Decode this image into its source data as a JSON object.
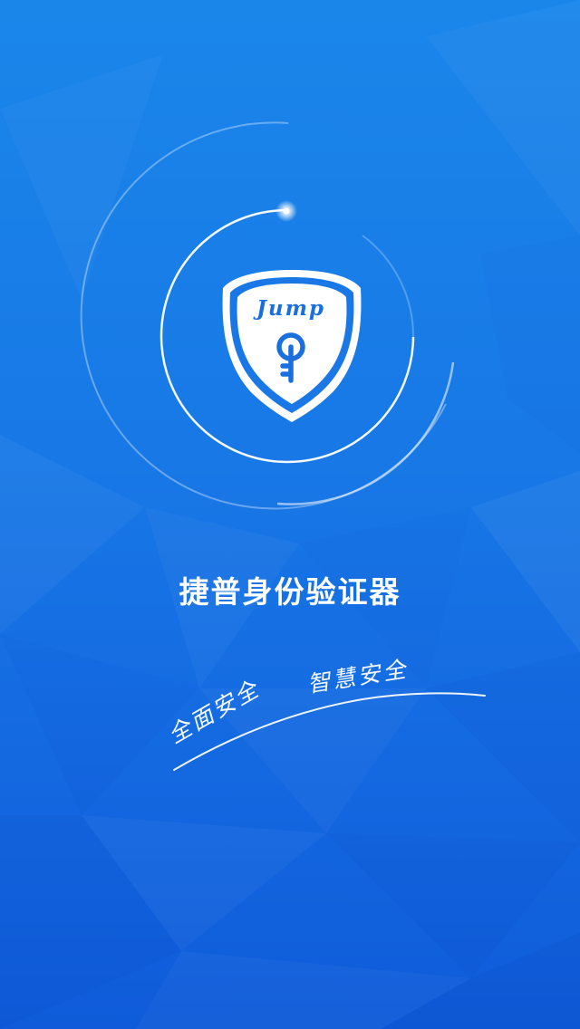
{
  "app": {
    "title": "捷普身份验证器"
  },
  "logo": {
    "wordmark": "Jump",
    "shield_color": "#1a78e6",
    "icon": "key-icon"
  },
  "slogans": {
    "left": "全面安全",
    "right": "智慧安全"
  },
  "colors": {
    "background_top": "#1a86ea",
    "background_bottom": "#0f5bd9",
    "foreground": "#ffffff"
  }
}
